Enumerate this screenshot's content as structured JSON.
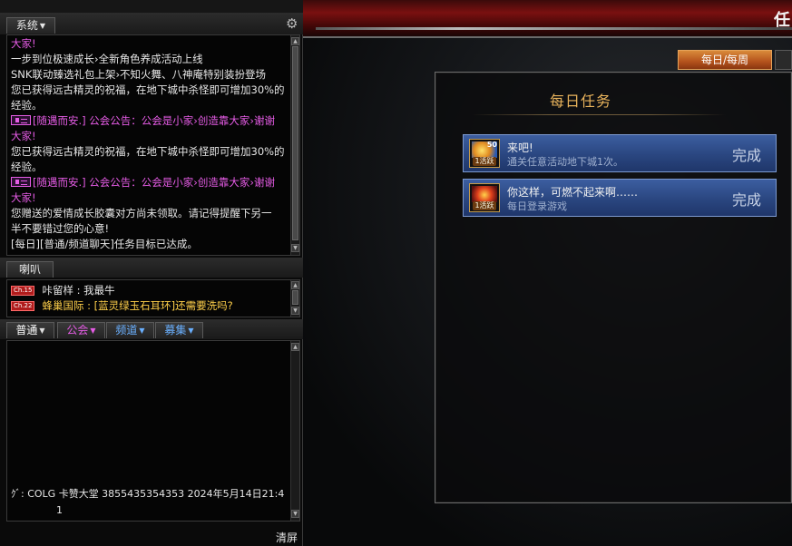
{
  "system_tab": {
    "label": "系统"
  },
  "system_log": [
    {
      "text": "大家!",
      "color": "pink"
    },
    {
      "text": "一步到位极速成长›全新角色养成活动上线",
      "color": "white"
    },
    {
      "text": "SNK联动臻选礼包上架›不知火舞、八神庵特别装扮登场",
      "color": "white"
    },
    {
      "text": "您已获得远古精灵的祝福，在地下城中杀怪即可增加30%的",
      "color": "white"
    },
    {
      "text": "经验。",
      "color": "white"
    },
    {
      "text": "[随遇而安.] 公会公告：公会是小家›创造靠大家›谢谢",
      "color": "pink",
      "horn": true
    },
    {
      "text": "大家!",
      "color": "pink"
    },
    {
      "text": "您已获得远古精灵的祝福，在地下城中杀怪即可增加30%的",
      "color": "white"
    },
    {
      "text": "经验。",
      "color": "white"
    },
    {
      "text": "[随遇而安.] 公会公告：公会是小家›创造靠大家›谢谢",
      "color": "pink",
      "horn": true
    },
    {
      "text": "大家!",
      "color": "pink"
    },
    {
      "text": "您赠送的爱情成长胶囊对方尚未领取。请记得提醒下另一",
      "color": "white"
    },
    {
      "text": "半不要错过您的心意!",
      "color": "white"
    },
    {
      "text": "[每日][普通/频道聊天]任务目标已达成。",
      "color": "white"
    }
  ],
  "horn_tab": {
    "label": "喇叭"
  },
  "horn_log": [
    {
      "channel": "Ch.15",
      "sender": "咔留样",
      "message": "我最牛",
      "color": "white"
    },
    {
      "channel": "Ch.22",
      "sender": "蜂巢国际",
      "message": "[蓝灵绿玉石耳环]还需要洗吗?",
      "color": "yellow"
    }
  ],
  "chat_tabs": [
    {
      "label": "普通",
      "color": "#ffffff"
    },
    {
      "label": "公会",
      "color": "#e65ce6"
    },
    {
      "label": "频道",
      "color": "#6ab0ff"
    },
    {
      "label": "募集",
      "color": "#6ab0ff"
    }
  ],
  "chat_footer": {
    "line1": "ｸﾞ: COLG  卡赞大堂  3855435354353  2024年5月14日21:4",
    "line2": "1",
    "clear_label": "清屏"
  },
  "game": {
    "title_char": "任",
    "tab_label": "每日/每周",
    "panel_title": "每日任务",
    "quests": [
      {
        "name": "来吧!",
        "desc": "通关任意活动地下城1次。",
        "status": "完成",
        "icon_num": "50",
        "icon_badge": "1活跃"
      },
      {
        "name": "你这样，可燃不起来啊……",
        "desc": "每日登录游戏",
        "status": "完成",
        "icon_num": "",
        "icon_badge": "1活跃"
      }
    ]
  }
}
